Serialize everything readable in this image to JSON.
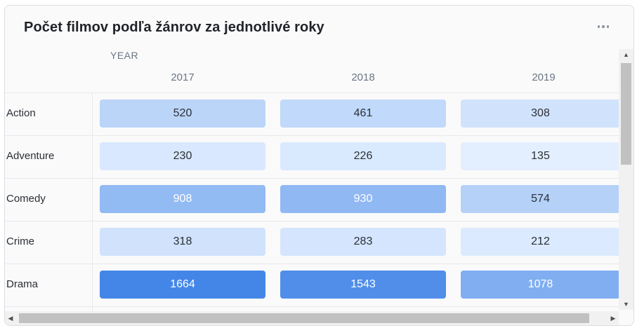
{
  "title": "Počet filmov podľa žánrov za jednotlivé roky",
  "column_group_label": "YEAR",
  "columns": [
    "2017",
    "2018",
    "2019"
  ],
  "rows": [
    {
      "genre": "Action",
      "values": [
        "520",
        "461",
        "308"
      ]
    },
    {
      "genre": "Adventure",
      "values": [
        "230",
        "226",
        "135"
      ]
    },
    {
      "genre": "Comedy",
      "values": [
        "908",
        "930",
        "574"
      ]
    },
    {
      "genre": "Crime",
      "values": [
        "318",
        "283",
        "212"
      ]
    },
    {
      "genre": "Drama",
      "values": [
        "1664",
        "1543",
        "1078"
      ]
    }
  ],
  "colors": {
    "scale_low": "#e3efff",
    "scale_high": "#4386e8",
    "text_dark": "#2a2f36",
    "text_light": "#ffffff"
  },
  "icons": {
    "menu": "more-horizontal-icon",
    "scroll_up": "arrow-up-icon",
    "scroll_down": "arrow-down-icon",
    "scroll_left": "arrow-left-icon",
    "scroll_right": "arrow-right-icon"
  }
}
